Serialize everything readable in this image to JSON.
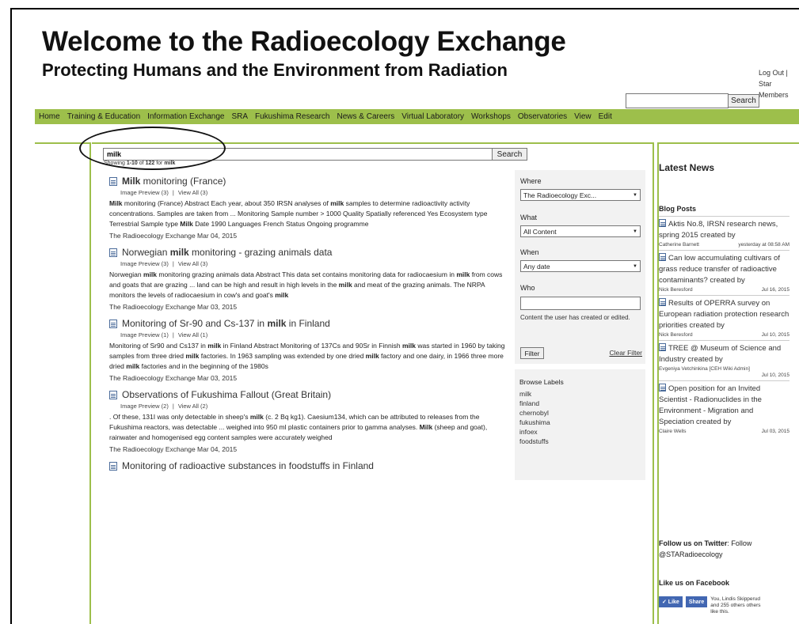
{
  "header": {
    "title": "Welcome to the Radioecology Exchange",
    "subtitle": "Protecting Humans and the Environment from Radiation"
  },
  "toplinks": {
    "logout": "Log Out |",
    "star": "Star",
    "members": "Members"
  },
  "top_search": {
    "button": "Search"
  },
  "nav": [
    "Home",
    "Training & Education",
    "Information Exchange",
    "SRA",
    "Fukushima Research",
    "News & Careers",
    "Virtual Laboratory",
    "Workshops",
    "Observatories",
    "View",
    "Edit"
  ],
  "search": {
    "value": "milk",
    "button": "Search",
    "showing_prefix": "Showing",
    "range": "1-10",
    "of": "of",
    "total": "122",
    "for": "for",
    "term": "milk"
  },
  "results": [
    {
      "title": "Milk monitoring (France)",
      "preview": "Image Preview (3)",
      "viewall": "View All (3)",
      "desc": "Milk monitoring (France) Abstract Each year, about 350 IRSN analyses of milk samples to determine radioactivity activity concentrations. Samples are taken from ... Monitoring Sample number > 1000 Quality Spatially referenced Yes Ecosystem type Terrestrial Sample type Milk Date 1990 Languages French Status Ongoing programme",
      "source": "The Radioecology Exchange   Mar 04, 2015"
    },
    {
      "title": "Norwegian milk monitoring - grazing animals data",
      "preview": "Image Preview (3)",
      "viewall": "View All (3)",
      "desc": "Norwegian milk monitoring grazing animals data Abstract This data set contains monitoring data for radiocaesium in milk from cows and goats that are grazing ... land can be high and result in high levels in the milk and meat of the grazing animals. The NRPA monitors the levels of radiocaesium in cow's and goat's milk",
      "source": "The Radioecology Exchange   Mar 03, 2015"
    },
    {
      "title": "Monitoring of Sr-90 and Cs-137 in milk in Finland",
      "preview": "Image Preview (1)",
      "viewall": "View All (1)",
      "desc": "Monitoring of Sr90 and Cs137 in milk in Finland Abstract Monitoring of 137Cs and 90Sr in Finnish milk was started in 1960 by taking samples from three dried milk factories. In 1963 sampling was extended by one dried milk factory and one dairy, in 1966 three more dried milk factories and in the beginning of the 1980s",
      "source": "The Radioecology Exchange   Mar 03, 2015"
    },
    {
      "title": "Observations of Fukushima Fallout (Great Britain)",
      "preview": "Image Preview (2)",
      "viewall": "View All (2)",
      "desc": ". Of these, 131I was only detectable in sheep's milk (c. 2 Bq kg1). Caesium134, which can be attributed to releases from the Fukushima reactors, was detectable ... weighed into 950 ml plastic containers prior to gamma analyses. Milk (sheep and goat), rainwater and homogenised egg content samples were accurately weighed",
      "source": "The Radioecology Exchange   Mar 04, 2015"
    },
    {
      "title": "Monitoring of radioactive substances in foodstuffs in Finland",
      "preview": "",
      "viewall": "",
      "desc": "",
      "source": ""
    }
  ],
  "filter": {
    "where_label": "Where",
    "where_value": "The Radioecology Exc...",
    "what_label": "What",
    "what_value": "All Content",
    "when_label": "When",
    "when_value": "Any date",
    "who_label": "Who",
    "who_hint": "Content the user has created or edited.",
    "filter_button": "Filter",
    "clear": "Clear Filter"
  },
  "browse": {
    "heading": "Browse Labels",
    "labels": [
      "milk",
      "finland",
      "chernobyl",
      "fukushima",
      "infoex",
      "foodstuffs"
    ]
  },
  "sidebar": {
    "latest_news": "Latest News",
    "blog_posts": "Blog Posts",
    "posts": [
      {
        "title": "Aktis No.8, IRSN research news, spring 2015 created by",
        "author": "Catherine Barnett",
        "date": "yesterday at 08:58 AM"
      },
      {
        "title": "Can low accumulating cultivars of grass reduce transfer of radioactive contaminants? created by",
        "author": "Nick Beresford",
        "date": "Jul 16, 2015"
      },
      {
        "title": "Results of OPERRA survey on European radiation protection research priorities created by",
        "author": "Nick Beresford",
        "date": "Jul 10, 2015"
      },
      {
        "title": "TREE @ Museum of Science and Industry created by",
        "author": "Evgeniya Vetchinkina [CEH Wiki Admin]",
        "date": "Jul 10, 2015"
      },
      {
        "title": "Open position for an Invited Scientist - Radionuclides in the Environment - Migration and Speciation created by",
        "author": "Claire Wells",
        "date": "Jul 03, 2015"
      }
    ],
    "follow_bold": "Follow us on Twitter",
    "follow_rest": ": Follow @STARadioecology",
    "facebook_heading": "Like us on Facebook",
    "fb_like": "✓ Like",
    "fb_share": "Share",
    "fb_text": "You, Lindis Skipperud and 255 others others like this."
  }
}
